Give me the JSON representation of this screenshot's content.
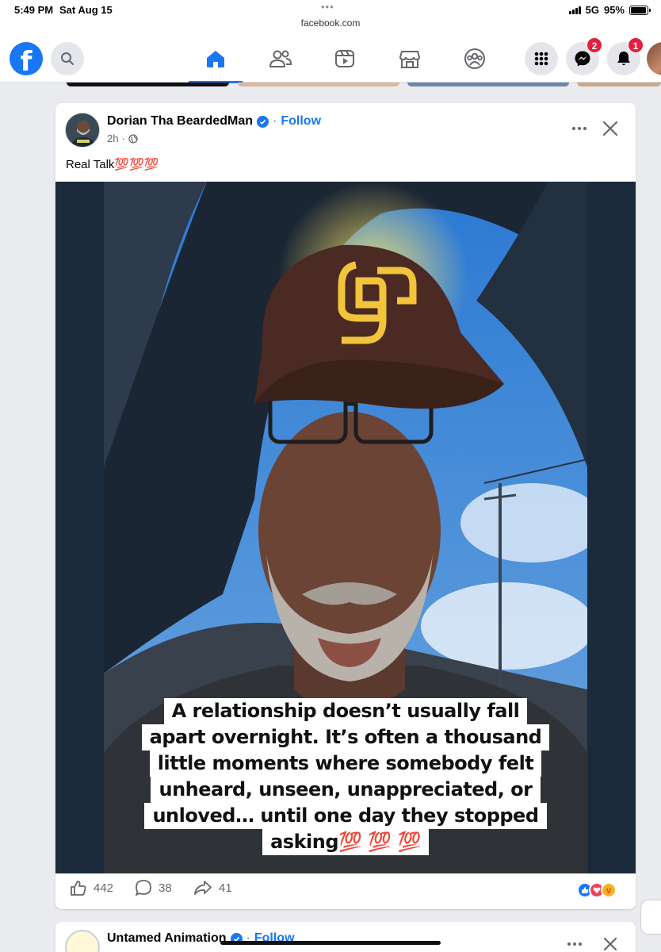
{
  "status_bar": {
    "time": "5:49 PM",
    "date": "Sat Aug 15",
    "url": "facebook.com",
    "network": "5G",
    "battery": "95%",
    "battery_level": 0.95
  },
  "topnav": {
    "logo": "f",
    "messenger_badge": "2",
    "notifications_badge": "1",
    "icons": [
      "facebook-logo",
      "search-icon",
      "home-icon",
      "friends-icon",
      "video-icon",
      "marketplace-icon",
      "groups-icon",
      "menu-grid-icon",
      "messenger-icon",
      "bell-icon"
    ]
  },
  "post": {
    "author": "Dorian Tha BeardedMan",
    "separator": "·",
    "follow": "Follow",
    "time": "2h",
    "meta_separator": "·",
    "caption": "Real Talk💯💯💯",
    "overlay_lines": [
      "A relationship doesn’t usually fall",
      "apart overnight. It’s often a thousand",
      "little moments where somebody felt",
      "unheard, unseen, unappreciated, or",
      "unloved… until one day they stopped",
      "asking💯 💯 💯"
    ],
    "likes": "442",
    "comments": "38",
    "shares": "41",
    "reaction_icons": [
      "like-reaction-icon",
      "love-reaction-icon",
      "care-reaction-icon"
    ],
    "colors": {
      "brand": "#1877f2",
      "like": "#1877f2",
      "love": "#f33e58",
      "care": "#f7b125"
    }
  },
  "next_post": {
    "author": "Untamed Animation",
    "follow": "Follow",
    "separator": "·"
  }
}
